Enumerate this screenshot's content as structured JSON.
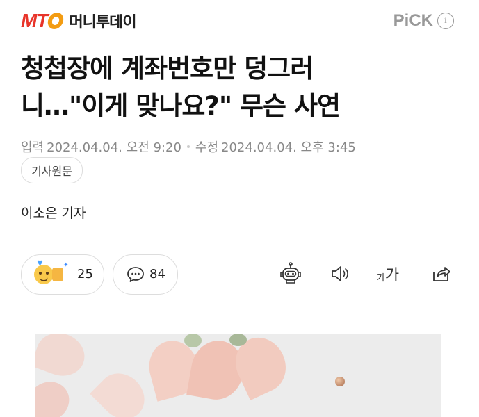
{
  "header": {
    "logo_mark": "MT",
    "logo_name": "머니투데이",
    "pick_label": "PiCK",
    "pick_info_glyph": "i"
  },
  "article": {
    "title_line1": "청첩장에 계좌번호만 덩그러",
    "title_line2": "니…\"이게 맞나요?\" 무슨 사연",
    "input_label": "입력",
    "input_datetime": "2024.04.04. 오전 9:20",
    "modified_label": "수정",
    "modified_datetime": "2024.04.04. 오후 3:45",
    "origin_button": "기사원문",
    "reporter": "이소은 기자"
  },
  "actions": {
    "reaction_count": "25",
    "comment_count": "84",
    "font_size_small": "가",
    "font_size_big": "가"
  },
  "colors": {
    "brand_red": "#e8342a",
    "brand_orange": "#f39c12",
    "muted_text": "#888888"
  },
  "icons": [
    "reaction-emoji-icon",
    "comment-bubble-icon",
    "ai-robot-icon",
    "speaker-icon",
    "font-size-icon",
    "share-icon",
    "info-icon"
  ]
}
